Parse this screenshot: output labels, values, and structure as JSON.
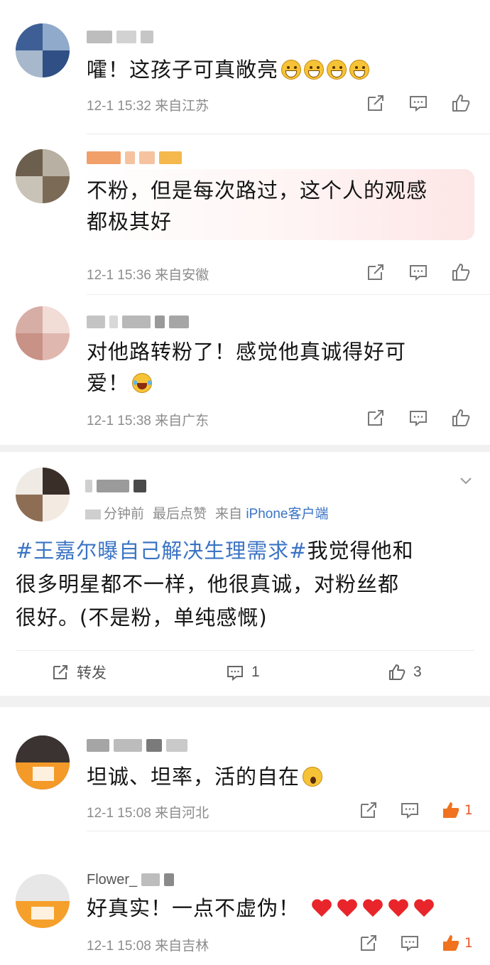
{
  "comments_top": [
    {
      "text": "嚯！这孩子可真敞亮",
      "emojis": [
        "grin",
        "grin",
        "grin",
        "grin"
      ],
      "date": "12-1 15:32",
      "location": "来自江苏"
    },
    {
      "text_line1": "不粉，但是每次路过，这个人的观感",
      "text_line2": "都极其好",
      "date": "12-1 15:36",
      "location": "来自安徽"
    },
    {
      "text_line1": "对他路转粉了！感觉他真诚得好可",
      "text_line2": "爱！",
      "emoji": "laugh",
      "date": "12-1 15:38",
      "location": "来自广东"
    }
  ],
  "post": {
    "meta_time": "分钟前",
    "meta_last": "最后点赞",
    "meta_from": "来自",
    "meta_source": "iPhone客户端",
    "hashtag": "#王嘉尔曝自己解决生理需求#",
    "line1_rest": "我觉得他和",
    "line2": "很多明星都不一样，他很真诚，对粉丝都",
    "line3": "很好。(不是粉，单纯感慨)",
    "repost_label": "转发",
    "comment_count": "1",
    "like_count": "3"
  },
  "comments_bottom": [
    {
      "text": "坦诚、坦率，活的自在",
      "emoji": "scream",
      "date": "12-1 15:08",
      "location": "来自河北",
      "like_count": "1"
    },
    {
      "username_partial": "Flower_",
      "text": "好真实！一点不虚伪！",
      "hearts": 5,
      "date": "12-1 15:08",
      "location": "来自吉林",
      "like_count": "1"
    }
  ]
}
